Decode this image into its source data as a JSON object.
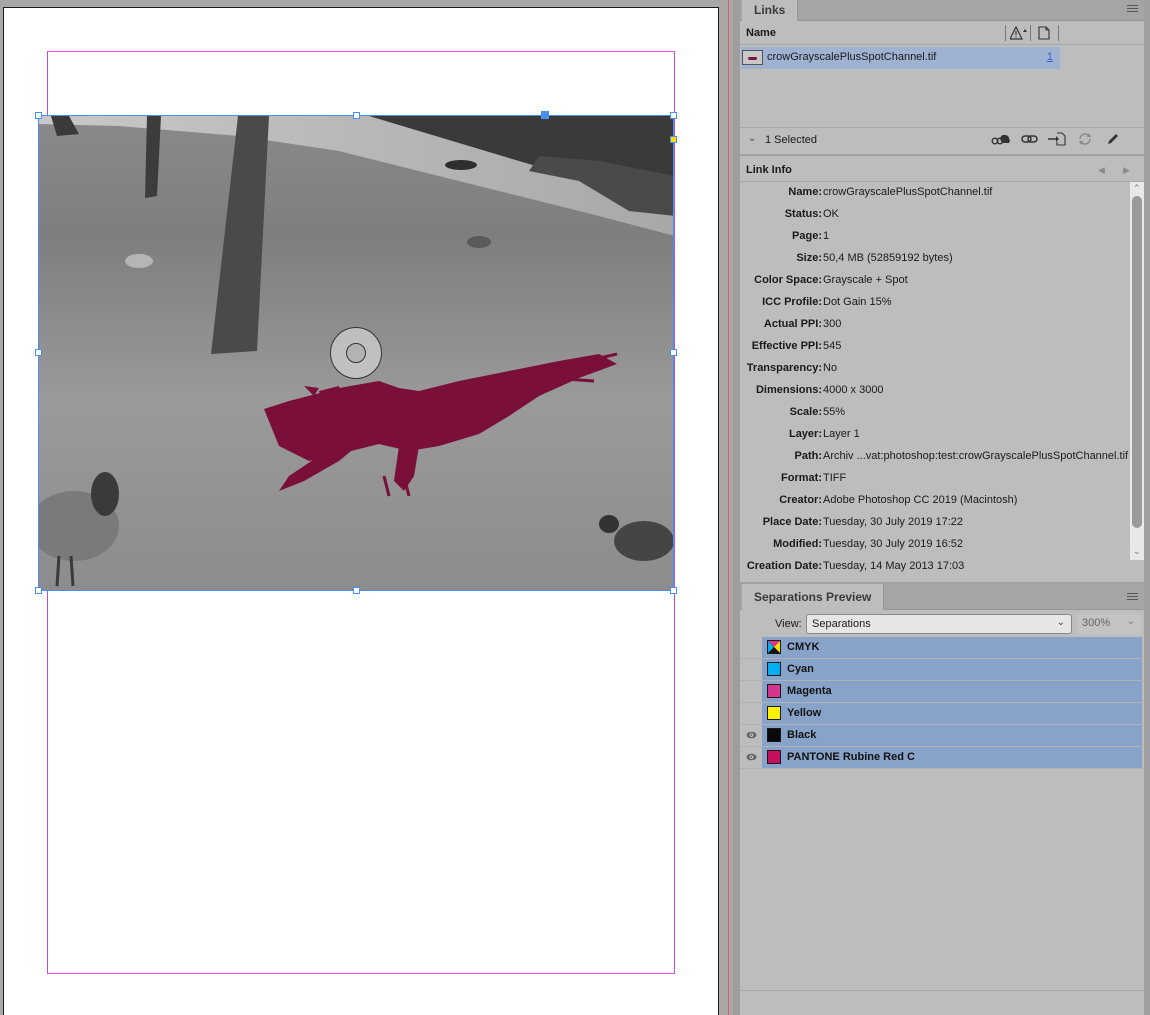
{
  "canvas": {
    "colors": {
      "page": "#ffffff",
      "margin_guide": "#f04ef0",
      "frame_selection": "#4a90f0",
      "pasteboard": "#a8a8a8",
      "spot_color": "#7a0f3a"
    },
    "image_description": "Grayscale photo of crows on a lawn with trees; the flying crow in the center is rendered in PANTONE Rubine Red spot color"
  },
  "links": {
    "tab_label": "Links",
    "column_name": "Name",
    "column_status_icon": "warning-sort-icon",
    "column_page_icon": "page-icon",
    "rows": [
      {
        "name": "crowGrayscalePlusSpotChannel.tif",
        "page": "1",
        "selected": true
      }
    ],
    "selected_count": "1 Selected",
    "toolbar": [
      {
        "icon": "relink-cc-libraries-icon"
      },
      {
        "icon": "relink-icon"
      },
      {
        "icon": "go-to-link-icon"
      },
      {
        "icon": "update-link-icon"
      },
      {
        "icon": "edit-original-icon"
      }
    ]
  },
  "link_info": {
    "title": "Link Info",
    "fields": [
      {
        "label": "Name:",
        "value": "crowGrayscalePlusSpotChannel.tif"
      },
      {
        "label": "Status:",
        "value": "OK"
      },
      {
        "label": "Page:",
        "value": "1"
      },
      {
        "label": "Size:",
        "value": "50,4 MB (52859192 bytes)"
      },
      {
        "label": "Color Space:",
        "value": "Grayscale + Spot"
      },
      {
        "label": "ICC Profile:",
        "value": "Dot Gain 15%"
      },
      {
        "label": "Actual PPI:",
        "value": "300"
      },
      {
        "label": "Effective PPI:",
        "value": "545"
      },
      {
        "label": "Transparency:",
        "value": "No"
      },
      {
        "label": "Dimensions:",
        "value": "4000 x 3000"
      },
      {
        "label": "Scale:",
        "value": "55%"
      },
      {
        "label": "Layer:",
        "value": "Layer 1"
      },
      {
        "label": "Path:",
        "value": "Archiv ...vat:photoshop:test:crowGrayscalePlusSpotChannel.tif"
      },
      {
        "label": "Format:",
        "value": "TIFF"
      },
      {
        "label": "Creator:",
        "value": "Adobe Photoshop CC 2019 (Macintosh)"
      },
      {
        "label": "Place Date:",
        "value": "Tuesday, 30 July 2019 17:22"
      },
      {
        "label": "Modified:",
        "value": "Tuesday, 30 July 2019 16:52"
      },
      {
        "label": "Creation Date:",
        "value": "Tuesday, 14 May 2013 17:03"
      }
    ]
  },
  "separations": {
    "tab_label": "Separations Preview",
    "view_label": "View:",
    "view_value": "Separations",
    "zoom_value": "300%",
    "plates": [
      {
        "name": "CMYK",
        "color": "cmyk",
        "visible": false
      },
      {
        "name": "Cyan",
        "color": "#00aeef",
        "visible": false
      },
      {
        "name": "Magenta",
        "color": "#d4358f",
        "visible": false
      },
      {
        "name": "Yellow",
        "color": "#fff200",
        "visible": false
      },
      {
        "name": "Black",
        "color": "#0a0a0a",
        "visible": true
      },
      {
        "name": "PANTONE Rubine Red C",
        "color": "#c4105e",
        "visible": true
      }
    ]
  }
}
